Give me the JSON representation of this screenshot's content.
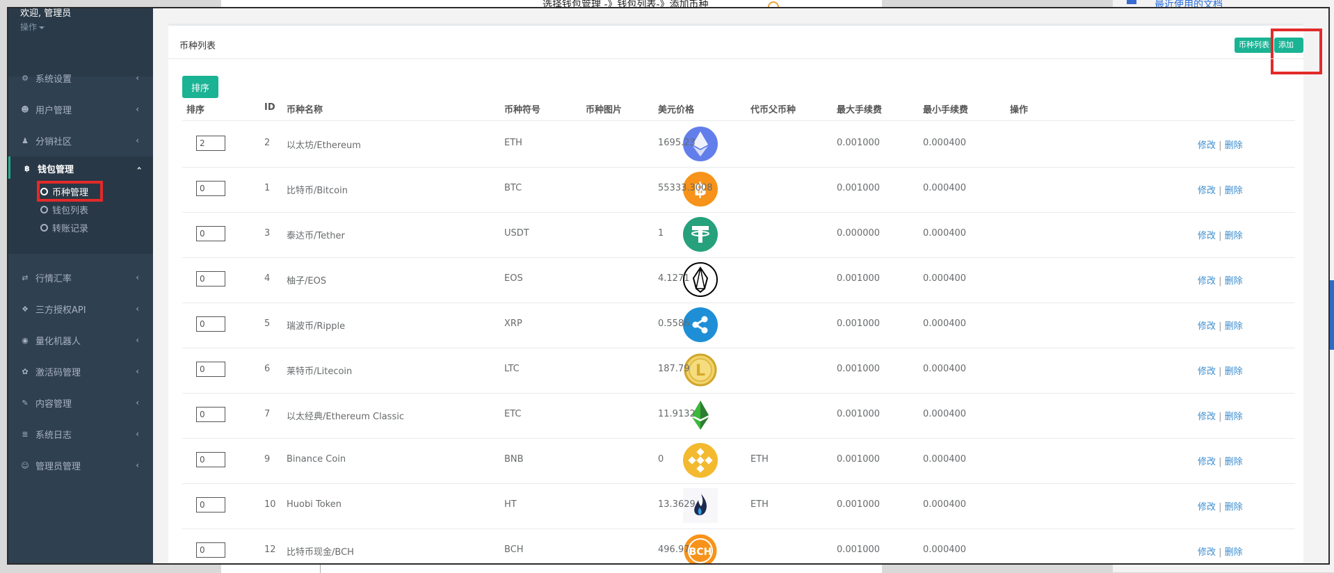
{
  "background": {
    "doc_line": "选择钱包管理 -》钱包列表-》添加币种",
    "recent_docs": "最近使用的文档"
  },
  "sidebar": {
    "welcome": "欢迎, 管理员",
    "operation": "操作",
    "items": [
      {
        "label": "系统设置",
        "icon": "gears-icon",
        "glyph": "⚙"
      },
      {
        "label": "用户管理",
        "icon": "users-icon",
        "glyph": "☻"
      },
      {
        "label": "分销社区",
        "icon": "user-icon",
        "glyph": "♟"
      },
      {
        "label": "钱包管理",
        "icon": "bitcoin-icon",
        "glyph": "฿"
      },
      {
        "label": "行情汇率",
        "icon": "exchange-icon",
        "glyph": "⇄"
      },
      {
        "label": "三方授权API",
        "icon": "cube-icon",
        "glyph": "❖"
      },
      {
        "label": "量化机器人",
        "icon": "android-icon",
        "glyph": "◉"
      },
      {
        "label": "激活码管理",
        "icon": "gear-icon",
        "glyph": "✿"
      },
      {
        "label": "内容管理",
        "icon": "edit-icon",
        "glyph": "✎"
      },
      {
        "label": "系统日志",
        "icon": "database-icon",
        "glyph": "≣"
      },
      {
        "label": "管理员管理",
        "icon": "user-circle-icon",
        "glyph": "☺"
      }
    ],
    "wallet_sub": [
      {
        "label": "币种管理"
      },
      {
        "label": "钱包列表"
      },
      {
        "label": "转账记录"
      }
    ]
  },
  "panel": {
    "title": "币种列表",
    "btn_list": "币种列表",
    "btn_add": "添加币种",
    "btn_sort": "排序"
  },
  "table": {
    "headers": [
      "排序",
      "ID",
      "币种名称",
      "币种符号",
      "币种图片",
      "美元价格",
      "代币父币种",
      "最大手续费",
      "最小手续费",
      "操作"
    ],
    "action_edit": "修改",
    "action_sep": "|",
    "action_delete": "删除",
    "rows": [
      {
        "order": "2",
        "id": "2",
        "name": "以太坊/Ethereum",
        "symbol": "ETH",
        "logo": "eth-logo",
        "price": "1695.23",
        "parent": "",
        "max_fee": "0.001000",
        "min_fee": "0.000400"
      },
      {
        "order": "0",
        "id": "1",
        "name": "比特币/Bitcoin",
        "symbol": "BTC",
        "logo": "btc-logo",
        "price": "55333.3008",
        "parent": "",
        "max_fee": "0.001000",
        "min_fee": "0.000400"
      },
      {
        "order": "0",
        "id": "3",
        "name": "泰达币/Tether",
        "symbol": "USDT",
        "logo": "usdt-logo",
        "price": "1",
        "parent": "",
        "max_fee": "0.000000",
        "min_fee": "0.000400"
      },
      {
        "order": "0",
        "id": "4",
        "name": "柚子/EOS",
        "symbol": "EOS",
        "logo": "eos-logo",
        "price": "4.1271",
        "parent": "",
        "max_fee": "0.001000",
        "min_fee": "0.000400"
      },
      {
        "order": "0",
        "id": "5",
        "name": "瑞波币/Ripple",
        "symbol": "XRP",
        "logo": "xrp-logo",
        "price": "0.5586",
        "parent": "",
        "max_fee": "0.001000",
        "min_fee": "0.000400"
      },
      {
        "order": "0",
        "id": "6",
        "name": "莱特币/Litecoin",
        "symbol": "LTC",
        "logo": "ltc-logo",
        "price": "187.79",
        "parent": "",
        "max_fee": "0.001000",
        "min_fee": "0.000400"
      },
      {
        "order": "0",
        "id": "7",
        "name": "以太经典/Ethereum Classic",
        "symbol": "ETC",
        "logo": "etc-logo",
        "price": "11.9132",
        "parent": "",
        "max_fee": "0.001000",
        "min_fee": "0.000400"
      },
      {
        "order": "0",
        "id": "9",
        "name": "Binance Coin",
        "symbol": "BNB",
        "logo": "bnb-logo",
        "price": "0",
        "parent": "ETH",
        "max_fee": "0.001000",
        "min_fee": "0.000400"
      },
      {
        "order": "0",
        "id": "10",
        "name": "Huobi Token",
        "symbol": "HT",
        "logo": "ht-logo",
        "price": "13.3629",
        "parent": "ETH",
        "max_fee": "0.001000",
        "min_fee": "0.000400"
      },
      {
        "order": "0",
        "id": "12",
        "name": "比特币现金/BCH",
        "symbol": "BCH",
        "logo": "bch-logo",
        "price": "496.97",
        "parent": "",
        "max_fee": "0.001000",
        "min_fee": "0.000400",
        "logo_text": "BCH"
      }
    ]
  },
  "colors": {
    "sidebar_bg": "#2f4050",
    "accent": "#1ab394",
    "highlight": "#e32a2a",
    "link": "#3c8dd0"
  }
}
